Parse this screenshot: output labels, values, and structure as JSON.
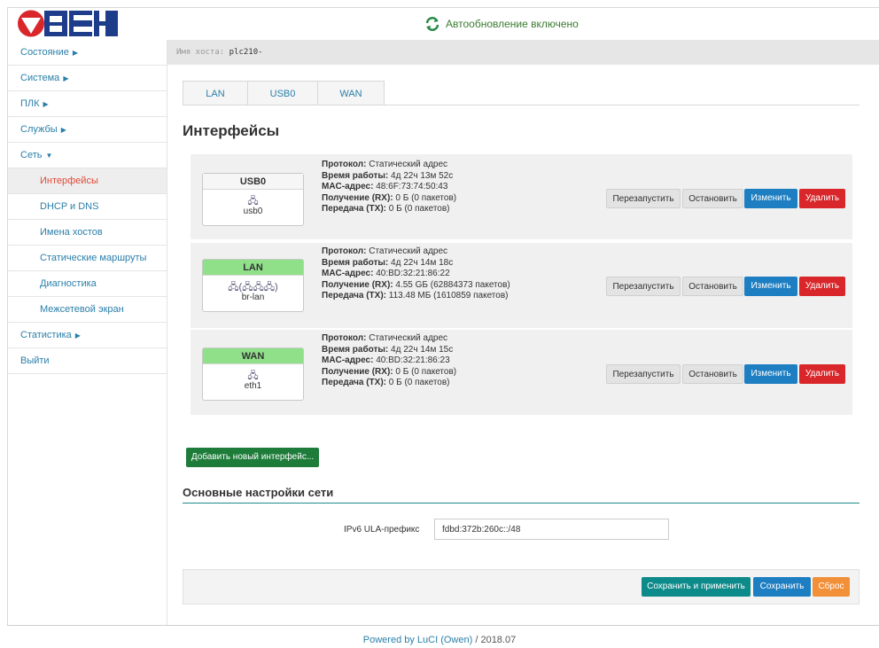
{
  "header": {
    "logo_text": "ОВЕН",
    "autorefresh": "Автообновление включено"
  },
  "sidebar": {
    "items": [
      {
        "label": "Состояние",
        "arrow": "▶"
      },
      {
        "label": "Система",
        "arrow": "▶"
      },
      {
        "label": "ПЛК",
        "arrow": "▶"
      },
      {
        "label": "Службы",
        "arrow": "▶"
      },
      {
        "label": "Сеть",
        "arrow": "▼"
      }
    ],
    "sub_items": [
      "Интерфейсы",
      "DHCP и DNS",
      "Имена хостов",
      "Статические маршруты",
      "Диагностика",
      "Межсетевой экран"
    ],
    "bottom_items": [
      {
        "label": "Статистика",
        "arrow": "▶"
      },
      {
        "label": "Выйти",
        "arrow": ""
      }
    ]
  },
  "hostbar": {
    "label": "Имя хоста:",
    "value": "plc210-"
  },
  "tabs": [
    "LAN",
    "USB0",
    "WAN"
  ],
  "page_title": "Интерфейсы",
  "interfaces": [
    {
      "name": "USB0",
      "device": "usb0",
      "icon": "🖧",
      "protocol_label": "Протокол:",
      "protocol": "Статический адрес",
      "uptime_label": "Время работы:",
      "uptime": "4д 22ч 13м 52с",
      "mac_label": "MAC-адрес:",
      "mac": "48:6F:73:74:50:43",
      "rx_label": "Получение (RX):",
      "rx": "0 Б (0 пакетов)",
      "tx_label": "Передача (TX):",
      "tx": "0 Б (0 пакетов)"
    },
    {
      "name": "LAN",
      "device": "br-lan",
      "icon": "🖧(🖧🖧🖧)",
      "protocol_label": "Протокол:",
      "protocol": "Статический адрес",
      "uptime_label": "Время работы:",
      "uptime": "4д 22ч 14м 18с",
      "mac_label": "MAC-адрес:",
      "mac": "40:BD:32:21:86:22",
      "rx_label": "Получение (RX):",
      "rx": "4.55 GБ (62884373 пакетов)",
      "tx_label": "Передача (TX):",
      "tx": "113.48 МБ (1610859 пакетов)"
    },
    {
      "name": "WAN",
      "device": "eth1",
      "icon": "🖧",
      "protocol_label": "Протокол:",
      "protocol": "Статический адрес",
      "uptime_label": "Время работы:",
      "uptime": "4д 22ч 14м 15с",
      "mac_label": "MAC-адрес:",
      "mac": "40:BD:32:21:86:23",
      "rx_label": "Получение (RX):",
      "rx": "0 Б (0 пакетов)",
      "tx_label": "Передача (TX):",
      "tx": "0 Б (0 пакетов)"
    }
  ],
  "iface_buttons": {
    "restart": "Перезапустить",
    "stop": "Остановить",
    "edit": "Изменить",
    "delete": "Удалить"
  },
  "add_interface": "Добавить новый интерфейс...",
  "general": {
    "title": "Основные настройки сети",
    "ula_label": "IPv6 ULA-префикс",
    "ula_value": "fdbd:372b:260c::/48"
  },
  "actions": {
    "save_apply": "Сохранить и применить",
    "save": "Сохранить",
    "reset": "Сброс"
  },
  "footer": {
    "link": "Powered by LuCI (Owen)",
    "sep": " / ",
    "version": "2018.07"
  },
  "colors": {
    "accent": "#2a7fa9",
    "active_nav": "#e14a3a",
    "lan_green": "#90e08a",
    "logo_blue": "#1d3d8a",
    "logo_red": "#d9262a"
  }
}
